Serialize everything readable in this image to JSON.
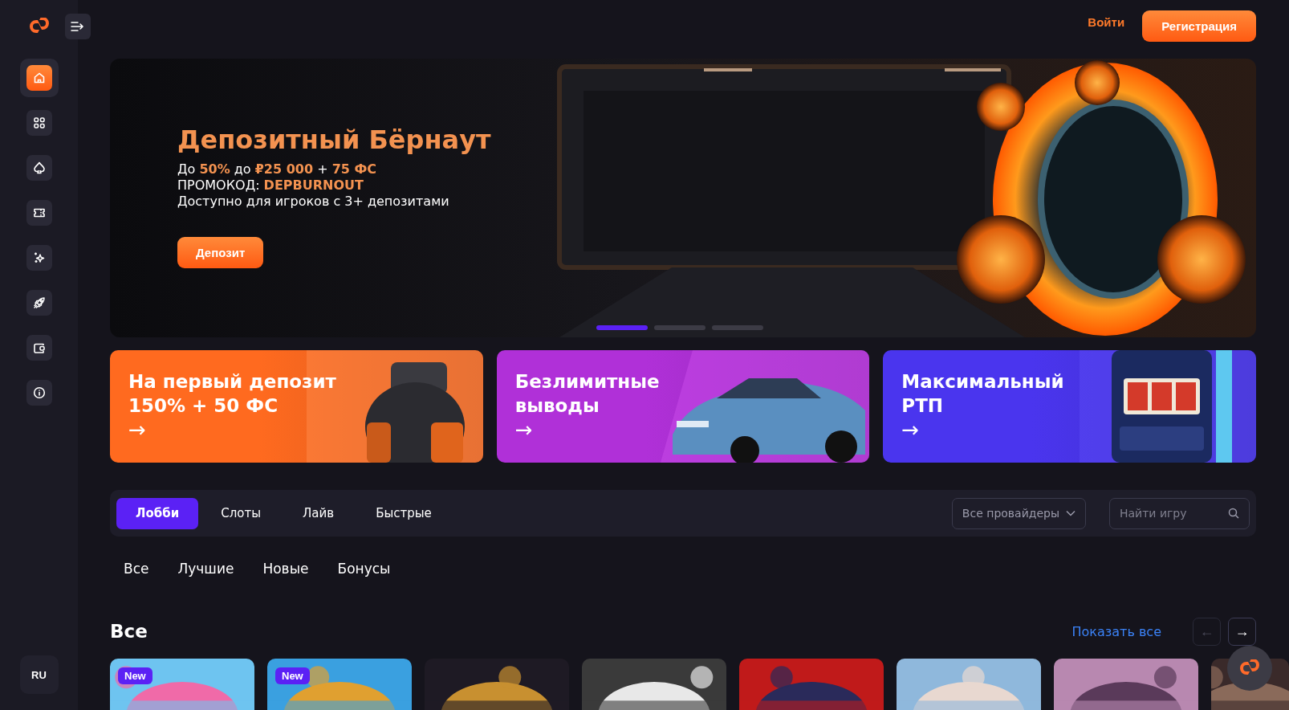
{
  "header": {
    "login": "Войти",
    "register": "Регистрация"
  },
  "sidebar": {
    "items": [
      {
        "kind": "home",
        "selected": true
      },
      {
        "kind": "grid",
        "selected": false
      },
      {
        "kind": "spade",
        "selected": false
      },
      {
        "kind": "ticket",
        "selected": false
      },
      {
        "kind": "sparkle",
        "selected": false
      },
      {
        "kind": "rocket",
        "selected": false
      },
      {
        "kind": "wallet",
        "selected": false
      },
      {
        "kind": "info",
        "selected": false
      }
    ],
    "language": "RU"
  },
  "banner": {
    "title": "Депозитный Бёрнаут",
    "lines": [
      "До **50%** до **₽25 000** + **75 ФС**",
      "ПРОМОКОД: **DEPBURNOUT**",
      "Доступно для игроков с 3+ депозитами"
    ],
    "button": "Депозит",
    "dots": [
      {
        "selected": true
      },
      {
        "selected": false
      },
      {
        "selected": false
      }
    ]
  },
  "promos": [
    {
      "lines": [
        "На первый депозит",
        "150% + 50 ФС"
      ],
      "arrow": "→",
      "color": "#ff6a1f"
    },
    {
      "lines": [
        "Безлимитные",
        "выводы"
      ],
      "arrow": "→",
      "color": "#b030d8"
    },
    {
      "lines": [
        "Максимальный",
        "РТП"
      ],
      "arrow": "→",
      "color": "#4a35ee"
    }
  ],
  "tabs": [
    {
      "label": "Лобби",
      "selected": true
    },
    {
      "label": "Слоты",
      "selected": false
    },
    {
      "label": "Лайв",
      "selected": false
    },
    {
      "label": "Быстрые",
      "selected": false
    }
  ],
  "providers": "Все провайдеры",
  "search": {
    "placeholder": "Найти игру"
  },
  "categories": [
    "Все",
    "Лучшие",
    "Новые",
    "Бонусы"
  ],
  "section": {
    "title": "Все",
    "show_all": "Показать все",
    "prev": {
      "label": "←",
      "disabled": true
    },
    "next": {
      "label": "→",
      "disabled": false
    }
  },
  "games": [
    {
      "kind": "new",
      "badge": "New"
    },
    {
      "kind": "new",
      "badge": "New"
    },
    {
      "kind": "plain"
    },
    {
      "kind": "plain"
    },
    {
      "kind": "plain"
    },
    {
      "kind": "plain"
    },
    {
      "kind": "plain"
    },
    {
      "kind": "plain"
    }
  ]
}
